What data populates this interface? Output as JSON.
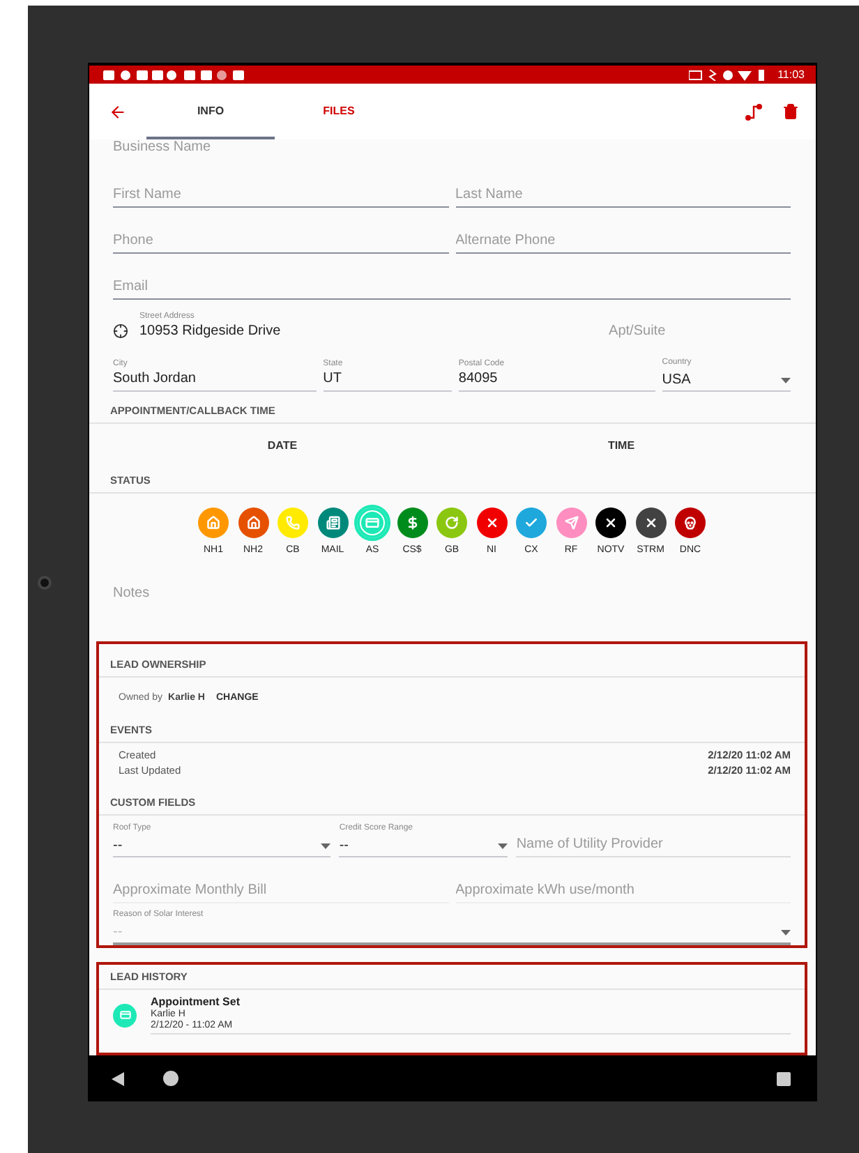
{
  "status_bar": {
    "time": "11:03"
  },
  "tabs": [
    {
      "label": "INFO",
      "selected": true
    },
    {
      "label": "FILES",
      "selected": false
    }
  ],
  "contact": {
    "business_name": {
      "placeholder": "Business Name"
    },
    "first_name": {
      "placeholder": "First Name"
    },
    "last_name": {
      "placeholder": "Last Name"
    },
    "phone": {
      "placeholder": "Phone"
    },
    "alternate_phone": {
      "placeholder": "Alternate Phone"
    },
    "email": {
      "placeholder": "Email"
    },
    "street_address": {
      "label": "Street Address",
      "value": "10953 Ridgeside Drive"
    },
    "apt_suite": {
      "placeholder": "Apt/Suite"
    },
    "city": {
      "label": "City",
      "value": "South Jordan"
    },
    "state": {
      "label": "State",
      "value": "UT"
    },
    "postal_code": {
      "label": "Postal Code",
      "value": "84095"
    },
    "country": {
      "label": "Country",
      "value": "USA"
    }
  },
  "appointment": {
    "title": "APPOINTMENT/CALLBACK TIME",
    "date": "DATE",
    "time": "TIME"
  },
  "status": {
    "title": "STATUS",
    "items": [
      {
        "label": "NH1",
        "color": "#ff9800",
        "selected": false
      },
      {
        "label": "NH2",
        "color": "#e65100",
        "selected": false
      },
      {
        "label": "CB",
        "color": "#ffea00",
        "selected": false
      },
      {
        "label": "MAIL",
        "color": "#00897b",
        "selected": false
      },
      {
        "label": "AS",
        "color": "#1de9b6",
        "selected": true
      },
      {
        "label": "CS$",
        "color": "#008c1c",
        "selected": false
      },
      {
        "label": "GB",
        "color": "#8bc710",
        "selected": false
      },
      {
        "label": "NI",
        "color": "#f00000",
        "selected": false
      },
      {
        "label": "CX",
        "color": "#1ea8dc",
        "selected": false
      },
      {
        "label": "RF",
        "color": "#ff8ec0",
        "selected": false
      },
      {
        "label": "NOTV",
        "color": "#000000",
        "selected": false
      },
      {
        "label": "STRM",
        "color": "#424242",
        "selected": false
      },
      {
        "label": "DNC",
        "color": "#c00000",
        "selected": false
      }
    ]
  },
  "notes": {
    "placeholder": "Notes"
  },
  "lead_ownership": {
    "title": "LEAD OWNERSHIP",
    "owned_by": "Owned by",
    "owner": "Karlie H",
    "change": "CHANGE"
  },
  "events": {
    "title": "EVENTS",
    "items": [
      {
        "label": "Created",
        "value": "2/12/20 11:02 AM"
      },
      {
        "label": "Last Updated",
        "value": "2/12/20 11:02 AM"
      }
    ]
  },
  "custom_fields": {
    "title": "CUSTOM FIELDS",
    "roof_type": {
      "label": "Roof Type",
      "value": "--"
    },
    "credit_score_range": {
      "label": "Credit Score Range",
      "value": "--"
    },
    "utility_provider": {
      "placeholder": "Name of Utility Provider"
    },
    "monthly_bill": {
      "placeholder": "Approximate Monthly Bill"
    },
    "kwh_use": {
      "placeholder": "Approximate kWh use/month"
    },
    "solar_interest": {
      "label": "Reason of Solar Interest",
      "value": "--",
      "disabled": true
    }
  },
  "lead_history": {
    "title": "LEAD HISTORY",
    "items": [
      {
        "title": "Appointment Set",
        "user": "Karlie H",
        "time": "2/12/20 - 11:02 AM",
        "color": "#1de9b6"
      }
    ]
  }
}
